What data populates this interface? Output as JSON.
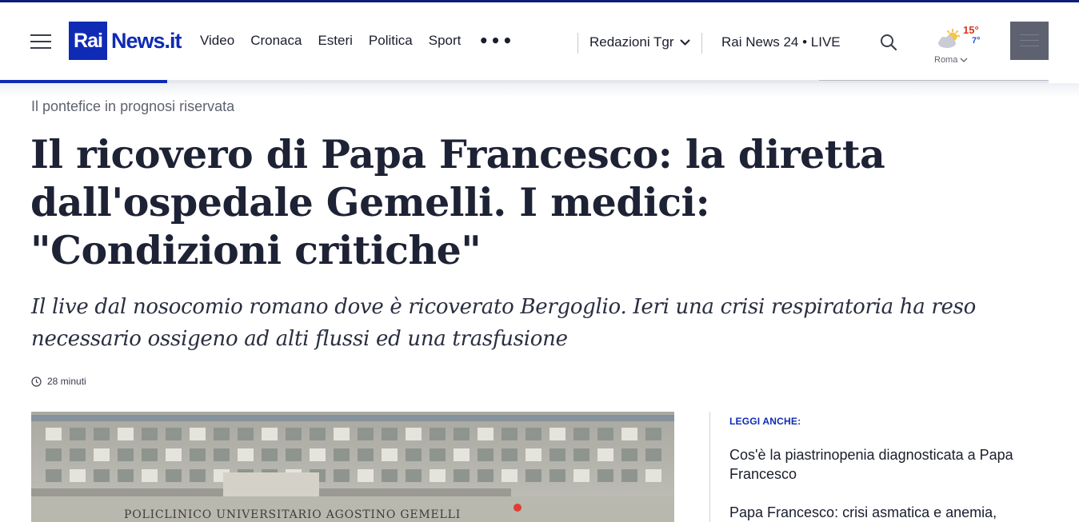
{
  "header": {
    "logo": {
      "rai": "Rai",
      "news": "News.it"
    },
    "nav": [
      "Video",
      "Cronaca",
      "Esteri",
      "Politica",
      "Sport"
    ],
    "more": "•••",
    "redazioni": "Redazioni Tgr",
    "live": "Rai News 24 • LIVE",
    "weather": {
      "high": "15°",
      "low": "7°",
      "city": "Roma"
    }
  },
  "article": {
    "kicker": "Il pontefice in prognosi riservata",
    "title": "Il ricovero di Papa Francesco: la diretta dall'ospedale Gemelli. I medici: \"Condizioni critiche\"",
    "subtitle": "Il live dal nosocomio romano dove è ricoverato Bergoglio. Ieri una crisi respiratoria ha reso necessario ossigeno ad alti flussi ed una trasfusione",
    "time": "28 minuti",
    "image_sign": "POLICLINICO UNIVERSITARIO AGOSTINO GEMELLI"
  },
  "aside": {
    "heading": "LEGGI ANCHE:",
    "items": [
      "Cos'è la piastrinopenia diagnosticata a Papa Francesco",
      "Papa Francesco: crisi asmatica e anemia,"
    ]
  },
  "colors": {
    "brand": "#0f2bb5",
    "text": "#1e2235",
    "hot": "#d9361f",
    "cold": "#2a53d8"
  },
  "icons": [
    "hamburger-icon",
    "chevron-down-icon",
    "search-icon",
    "weather-sun-cloud-icon",
    "clock-icon",
    "menu-grid-icon"
  ]
}
